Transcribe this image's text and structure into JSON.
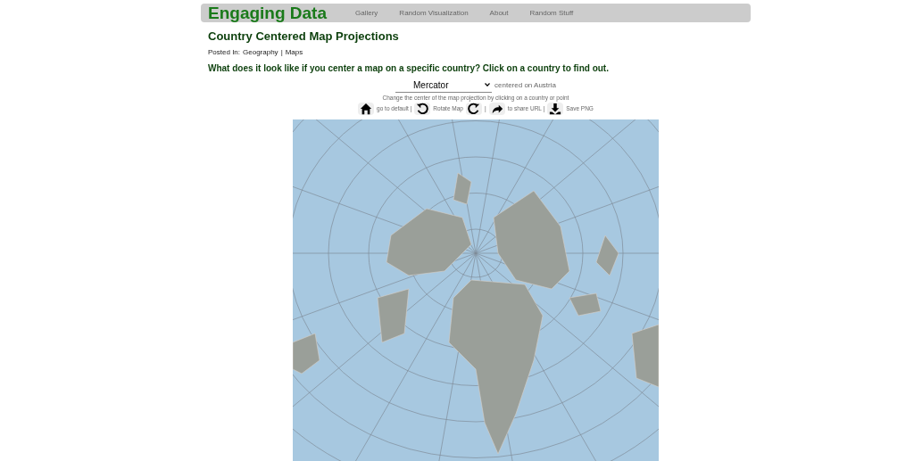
{
  "navbar": {
    "brand": "Engaging Data",
    "links": [
      "Gallery",
      "Random Visualization",
      "About",
      "Random Stuff"
    ]
  },
  "title": "Country Centered Map Projections",
  "posted": {
    "label": "Posted In:",
    "categories": [
      "Geography",
      "Maps"
    ],
    "separator": "|"
  },
  "question": "What does it look like if you center a map on a specific country? Click on a country to find out.",
  "projection": {
    "value": "Mercator",
    "suffix": "centered on Austria"
  },
  "hint": "Change the center of the map projection by clicking on a country or point",
  "toolbar": [
    {
      "kind": "home",
      "label": "go to default |"
    },
    {
      "kind": "rotate-left",
      "label": "Rotate Map"
    },
    {
      "kind": "rotate-right",
      "label": "|"
    },
    {
      "kind": "share",
      "label": "to share URL |"
    },
    {
      "kind": "download",
      "label": "Save PNG"
    }
  ]
}
